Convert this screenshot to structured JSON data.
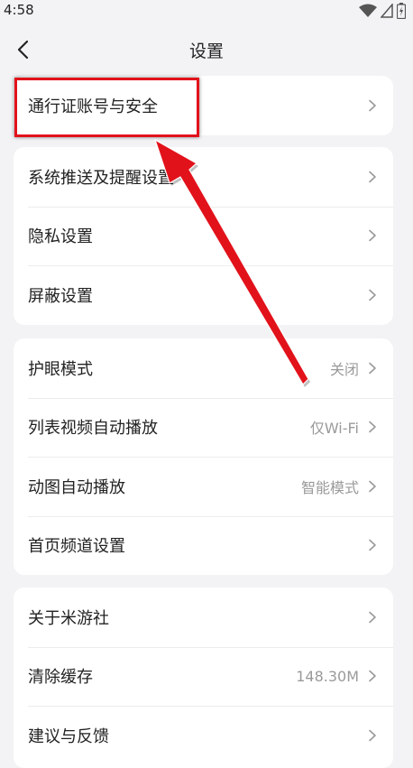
{
  "status_bar": {
    "time": "4:58",
    "icons": [
      "wifi-icon",
      "signal-icon",
      "battery-icon"
    ]
  },
  "header": {
    "title": "设置",
    "back_icon": "back-arrow-icon"
  },
  "groups": [
    {
      "items": [
        {
          "label": "通行证账号与安全",
          "value": ""
        }
      ]
    },
    {
      "items": [
        {
          "label": "系统推送及提醒设置",
          "value": ""
        },
        {
          "label": "隐私设置",
          "value": ""
        },
        {
          "label": "屏蔽设置",
          "value": ""
        }
      ]
    },
    {
      "items": [
        {
          "label": "护眼模式",
          "value": "关闭"
        },
        {
          "label": "列表视频自动播放",
          "value": "仅Wi-Fi"
        },
        {
          "label": "动图自动播放",
          "value": "智能模式"
        },
        {
          "label": "首页频道设置",
          "value": ""
        }
      ]
    },
    {
      "items": [
        {
          "label": "关于米游社",
          "value": ""
        },
        {
          "label": "清除缓存",
          "value": "148.30M"
        },
        {
          "label": "建议与反馈",
          "value": ""
        }
      ]
    }
  ],
  "colors": {
    "background": "#f3f3f5",
    "card": "#ffffff",
    "highlight": "#e2121b",
    "secondary_text": "#9a9a9a"
  }
}
